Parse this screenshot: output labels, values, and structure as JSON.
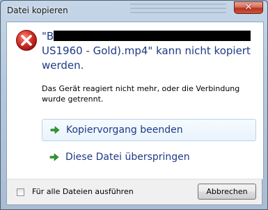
{
  "window": {
    "title": "Datei kopieren",
    "close_label": "✕"
  },
  "message": {
    "filename_prefix": "\"B",
    "filename_line2": "US1960 - Gold).mp4\" kann nicht kopiert",
    "filename_line3": "werden.",
    "detail": "Das Gerät reagiert nicht mehr, oder die Verbindung wurde getrennt."
  },
  "commands": [
    {
      "label": "Kopiervorgang beenden"
    },
    {
      "label": "Diese Datei überspringen"
    }
  ],
  "footer": {
    "checkbox_label": "Für alle Dateien ausführen",
    "checkbox_checked": false,
    "cancel_label": "Abbrechen"
  },
  "icons": {
    "error": "error-icon",
    "command_arrow": "green-arrow-icon",
    "close": "close-icon"
  },
  "colors": {
    "message_text": "#1e3a86",
    "error_red": "#c4221f",
    "arrow_green": "#2e9a2e"
  }
}
